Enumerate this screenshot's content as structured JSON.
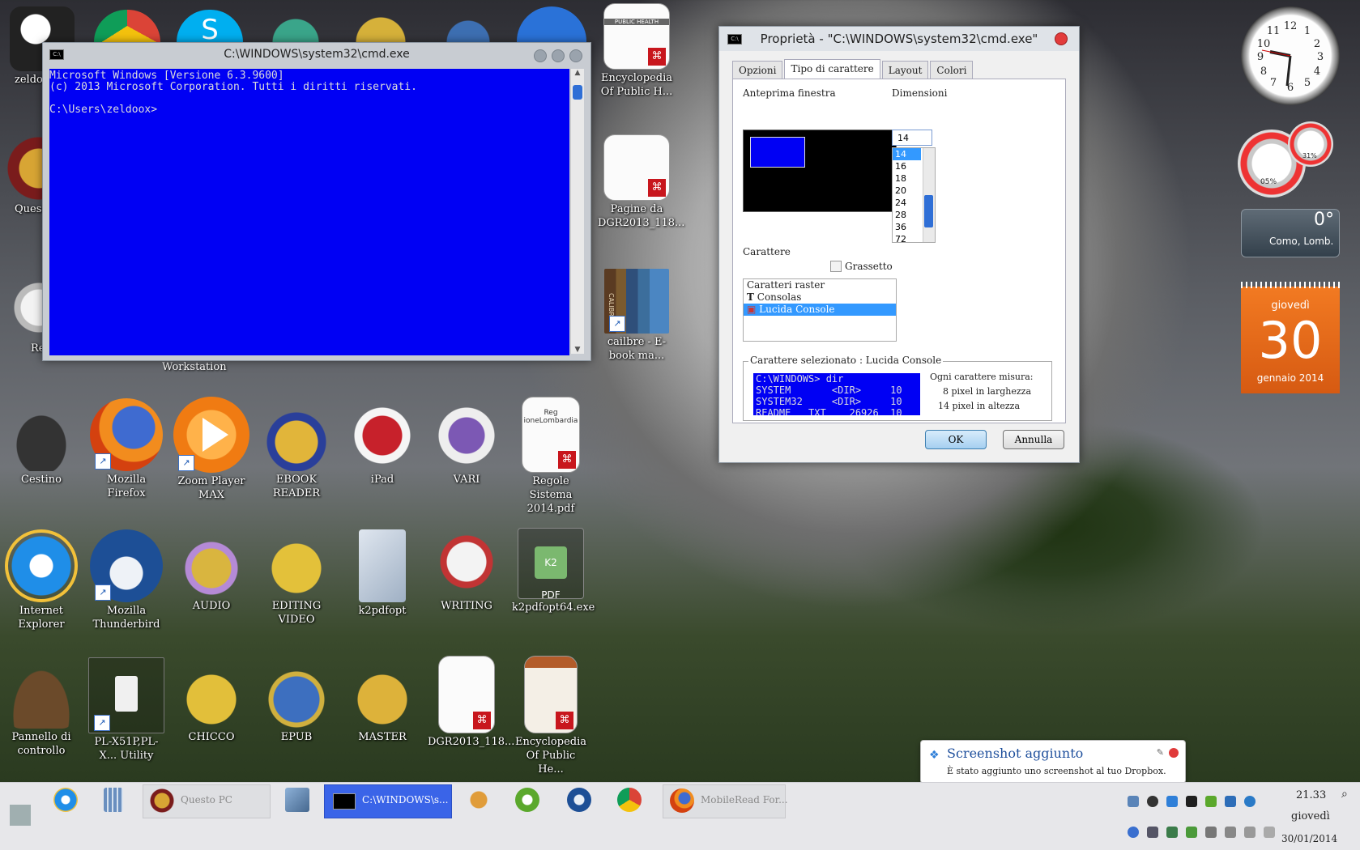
{
  "desktop": {
    "icons": [
      {
        "label": "zeldo",
        "color": "#222"
      },
      {
        "label": "Ques",
        "color": "#c9a23d"
      },
      {
        "label": "Re",
        "color": "#ddd"
      },
      {
        "label": "Workstation"
      },
      {
        "label": "Encyclopedia Of Public H...",
        "kind": "pdf"
      },
      {
        "label": "Pagine da DGR2013_118...",
        "kind": "pdf"
      },
      {
        "label": "cailbre - E-book ma...",
        "kind": "books"
      },
      {
        "label": "Cestino"
      },
      {
        "label": "Mozilla Firefox"
      },
      {
        "label": "Zoom Player MAX"
      },
      {
        "label": "EBOOK READER"
      },
      {
        "label": "iPad"
      },
      {
        "label": "VARI"
      },
      {
        "label": "Regole Sistema 2014.pdf"
      },
      {
        "label": "Internet Explorer"
      },
      {
        "label": "Mozilla Thunderbird"
      },
      {
        "label": "AUDIO"
      },
      {
        "label": "EDITING VIDEO"
      },
      {
        "label": "k2pdfopt"
      },
      {
        "label": "WRITING"
      },
      {
        "label": "k2pdfopt64.exe"
      },
      {
        "label": "Pannello di controllo"
      },
      {
        "label": "PL-X51P,PL-X... Utility"
      },
      {
        "label": "CHICCO"
      },
      {
        "label": "EPUB"
      },
      {
        "label": "MASTER"
      },
      {
        "label": "DGR2013_118..."
      },
      {
        "label": "Encyclopedia Of Public He..."
      }
    ],
    "k2_label": "K2 PDF",
    "doc_header": "PUBLIC HEALTH",
    "reg_text": "Reg ioneLombardia",
    "calibre_text": "CALIBRE"
  },
  "cmd_window": {
    "title": "C:\\WINDOWS\\system32\\cmd.exe",
    "lines": [
      "Microsoft Windows [Versione 6.3.9600]",
      "(c) 2013 Microsoft Corporation. Tutti i diritti riservati.",
      "",
      "C:\\Users\\zeldoox>"
    ],
    "colors": {
      "background": "#0000f4",
      "text": "#dcdcdc"
    }
  },
  "properties_dialog": {
    "title": "Proprietà - \"C:\\WINDOWS\\system32\\cmd.exe\"",
    "tabs": [
      "Opzioni",
      "Tipo di carattere",
      "Layout",
      "Colori"
    ],
    "active_tab": "Tipo di carattere",
    "preview_label": "Anteprima finestra",
    "size_label": "Dimensioni",
    "size_value": "14",
    "sizes": [
      "14",
      "16",
      "18",
      "20",
      "24",
      "28",
      "36",
      "72"
    ],
    "selected_size": "14",
    "font_label": "Carattere",
    "bold_label": "Grassetto",
    "fonts": [
      "Caratteri raster",
      "Consolas",
      "Lucida Console"
    ],
    "selected_font": "Lucida Console",
    "selected_group_label": "Carattere selezionato : Lucida Console",
    "sample_lines": [
      "C:\\WINDOWS> dir",
      "SYSTEM       <DIR>     10",
      "SYSTEM32     <DIR>     10",
      "README   TXT    26926  10"
    ],
    "measure_title": "Ogni carattere misura:",
    "measure_width": "8 pixel in larghezza",
    "measure_height": "14 pixel in altezza",
    "ok_label": "OK",
    "cancel_label": "Annulla"
  },
  "gadgets": {
    "clock_numbers": [
      "12",
      "1",
      "2",
      "3",
      "4",
      "5",
      "6",
      "7",
      "8",
      "9",
      "10",
      "11"
    ],
    "cpu_percent": "05%",
    "mem_percent": "31%",
    "weather_temp": "0°",
    "weather_location": "Como, Lomb.",
    "calendar_weekday": "giovedì",
    "calendar_day": "30",
    "calendar_month": "gennaio 2014"
  },
  "toast": {
    "title": "Screenshot aggiunto",
    "body": "È stato aggiunto uno screenshot al tuo Dropbox."
  },
  "taskbar": {
    "buttons": [
      {
        "label": "Questo PC"
      },
      {
        "label": "C:\\WINDOWS\\s..."
      },
      {
        "label": "MobileRead For..."
      }
    ],
    "clock_time": "21.33",
    "clock_day": "giovedì",
    "clock_date": "30/01/2014"
  }
}
